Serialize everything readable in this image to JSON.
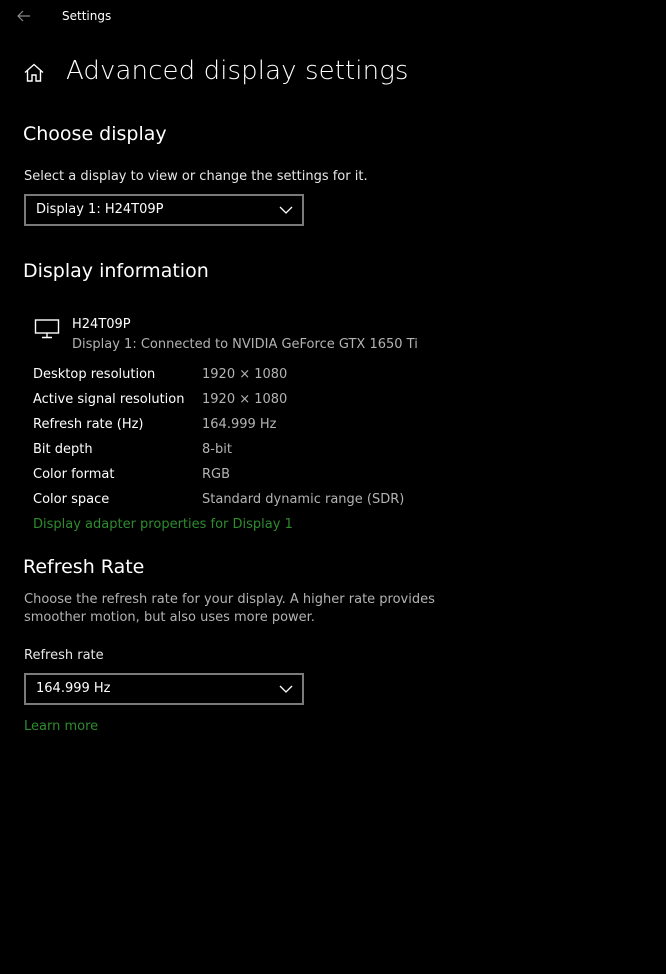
{
  "window": {
    "app_title": "Settings",
    "icons": {
      "back": "back-arrow-icon",
      "home": "home-icon"
    }
  },
  "page": {
    "title": "Advanced display settings"
  },
  "choose_display": {
    "heading": "Choose display",
    "description": "Select a display to view or change the settings for it.",
    "selected_display": "Display 1: H24T09P"
  },
  "display_information": {
    "heading": "Display information",
    "monitor_name": "H24T09P",
    "monitor_connection": "Display 1: Connected to NVIDIA GeForce GTX 1650 Ti",
    "rows": [
      {
        "label": "Desktop resolution",
        "value": "1920 × 1080"
      },
      {
        "label": "Active signal resolution",
        "value": "1920 × 1080"
      },
      {
        "label": "Refresh rate (Hz)",
        "value": "164.999 Hz"
      },
      {
        "label": "Bit depth",
        "value": "8-bit"
      },
      {
        "label": "Color format",
        "value": "RGB"
      },
      {
        "label": "Color space",
        "value": "Standard dynamic range (SDR)"
      }
    ],
    "adapter_link": "Display adapter properties for Display 1"
  },
  "refresh_rate": {
    "heading": "Refresh Rate",
    "description": "Choose the refresh rate for your display. A higher rate provides smoother motion, but also uses more power.",
    "field_label": "Refresh rate",
    "selected_value": "164.999 Hz",
    "learn_more": "Learn more"
  },
  "colors": {
    "background": "#000000",
    "text": "#ffffff",
    "muted_text": "#b3b3b3",
    "link": "#2e8b2e",
    "dropdown_border": "#7a7a7a"
  }
}
